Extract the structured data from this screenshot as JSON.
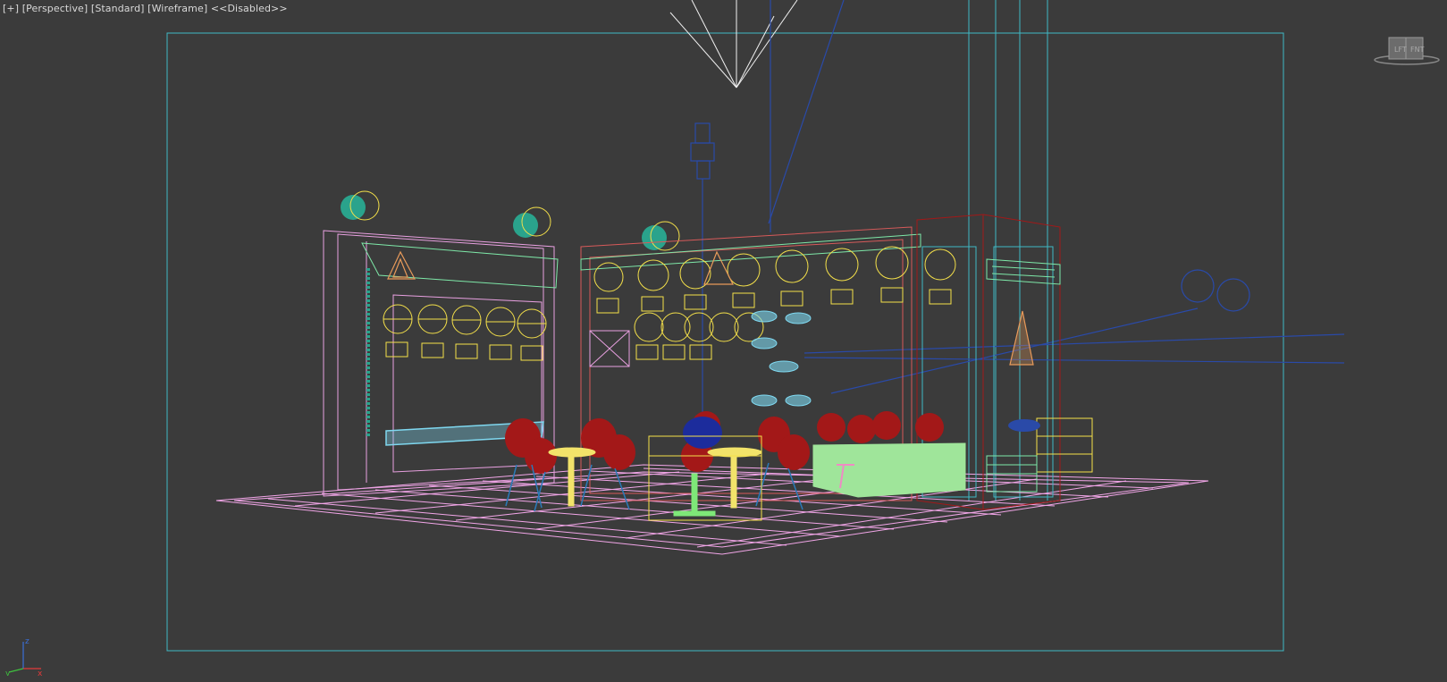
{
  "viewport": {
    "label_parts": [
      "[+]",
      "[Perspective]",
      "[Standard]",
      "[Wireframe]",
      "<<Disabled>>"
    ]
  },
  "viewcube": {
    "face_left": "LFT",
    "face_right": "FNT"
  },
  "axis": {
    "z": "z",
    "x": "x",
    "y": "y"
  },
  "colors": {
    "background": "#3b3b3b",
    "safe_frame": "#3fb8c6",
    "floor": "#f2a6e8",
    "walls": "#e8a0e0",
    "lamps": "#f4e04a",
    "chairs": "#a31818",
    "tables": "#f2e36a",
    "sofa": "#9fe59a",
    "blue_lines": "#2a4aa8",
    "camera": "#f0f0f0",
    "teal_objects": "#2aa38c",
    "cyan_shelf": "#7fd8f0",
    "orange_logo": "#e89a5a"
  }
}
